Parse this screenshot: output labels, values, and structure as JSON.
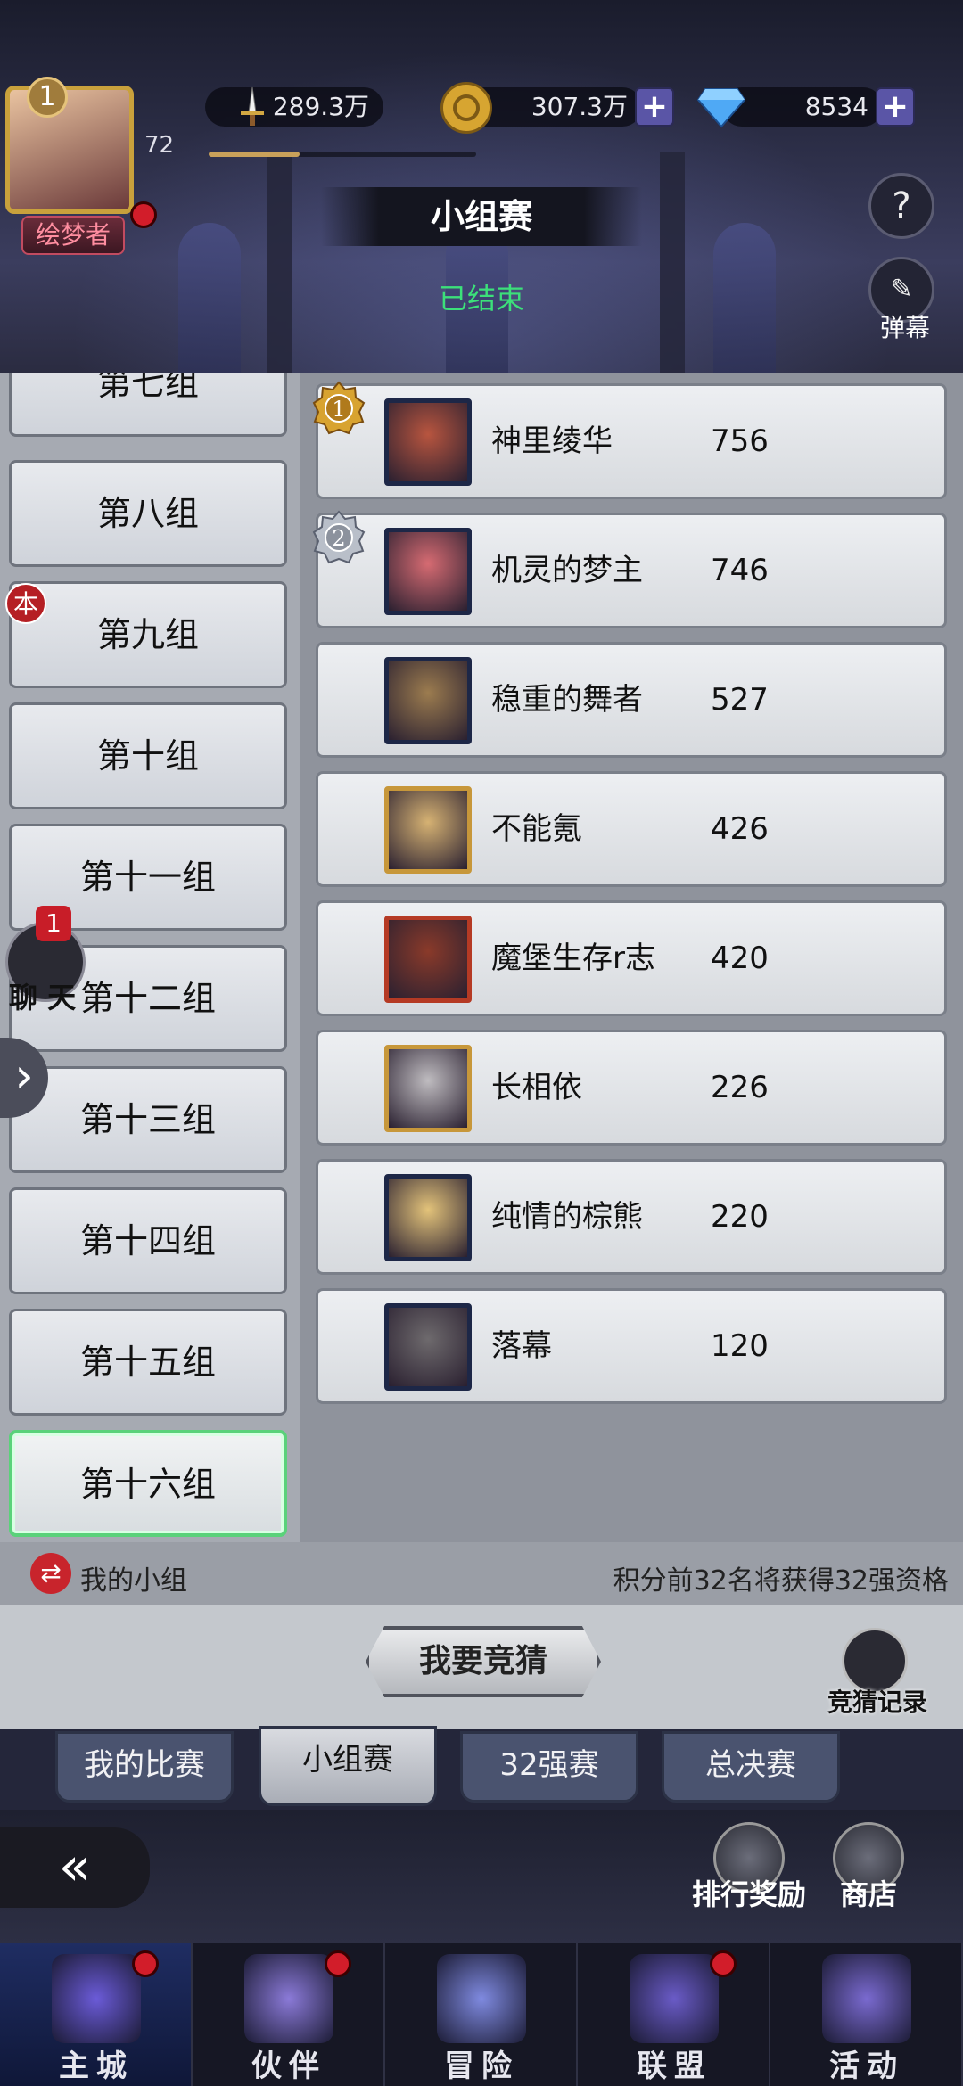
{
  "header": {
    "player_level_badge": "1",
    "player_level": "72",
    "player_title": "绘梦者",
    "currencies": [
      {
        "name": "sword-power",
        "icon": "sword-icon",
        "value": "289.3万"
      },
      {
        "name": "gold",
        "icon": "gold-coin-icon",
        "value": "307.3万"
      },
      {
        "name": "diamond",
        "icon": "diamond-icon",
        "value": "8534"
      }
    ],
    "xp_progress_fraction": 0.34,
    "page_title": "小组赛",
    "status": "已结束",
    "help_symbol": "?",
    "danmu_label": "弹幕"
  },
  "groups": {
    "partial_label": "第七组",
    "items": [
      "第八组",
      "第九组",
      "第十组",
      "第十一组",
      "第十二组",
      "第十三组",
      "第十四组",
      "第十五组",
      "第十六组"
    ],
    "selected": "第十六组",
    "own_group_badge": "本"
  },
  "ranking": [
    {
      "rank": 1,
      "medal": "1",
      "name": "神里绫华",
      "score": "756",
      "frame": "#1d2747",
      "bg": "#b8553f"
    },
    {
      "rank": 2,
      "medal": "2",
      "name": "机灵的梦主",
      "score": "746",
      "frame": "#1d2747",
      "bg": "#d66b72"
    },
    {
      "rank": 3,
      "name": "稳重的舞者",
      "score": "527",
      "frame": "#1d2747",
      "bg": "#9c7c4f"
    },
    {
      "rank": 4,
      "name": "不能氪",
      "score": "426",
      "frame": "#c7973a",
      "bg": "#d6b273"
    },
    {
      "rank": 5,
      "name": "魔堡生存r志",
      "score": "420",
      "frame": "#b53a24",
      "bg": "#8a3a2a"
    },
    {
      "rank": 6,
      "name": "长相依",
      "score": "226",
      "frame": "#c7973a",
      "bg": "#bfbcc0"
    },
    {
      "rank": 7,
      "name": "纯情的棕熊",
      "score": "220",
      "frame": "#1d2747",
      "bg": "#e3c37a"
    },
    {
      "rank": 8,
      "name": "落幕",
      "score": "120",
      "frame": "#1d2747",
      "bg": "#6e6a6d"
    }
  ],
  "chat": {
    "label": "聊 天",
    "count": "1"
  },
  "footer": {
    "my_group_label": "我的小组",
    "qualify_note": "积分前32名将获得32强资格",
    "guess_button": "我要竞猜",
    "guess_record": "竞猜记录"
  },
  "tabs": [
    {
      "label": "我的比赛",
      "active": false
    },
    {
      "label": "小组赛",
      "active": true
    },
    {
      "label": "32强赛",
      "active": false
    },
    {
      "label": "总决赛",
      "active": false
    }
  ],
  "lower": {
    "rank_reward": "排行奖励",
    "shop": "商店"
  },
  "bottom_nav": [
    {
      "label": "主城",
      "active": true,
      "dot": true,
      "color": "#6b5bd8"
    },
    {
      "label": "伙伴",
      "active": false,
      "dot": true,
      "color": "#8b7ad8"
    },
    {
      "label": "冒险",
      "active": false,
      "dot": false,
      "color": "#7f8ae0"
    },
    {
      "label": "联盟",
      "active": false,
      "dot": true,
      "color": "#6a5bc7"
    },
    {
      "label": "活动",
      "active": false,
      "dot": false,
      "color": "#7a6ad0"
    }
  ]
}
